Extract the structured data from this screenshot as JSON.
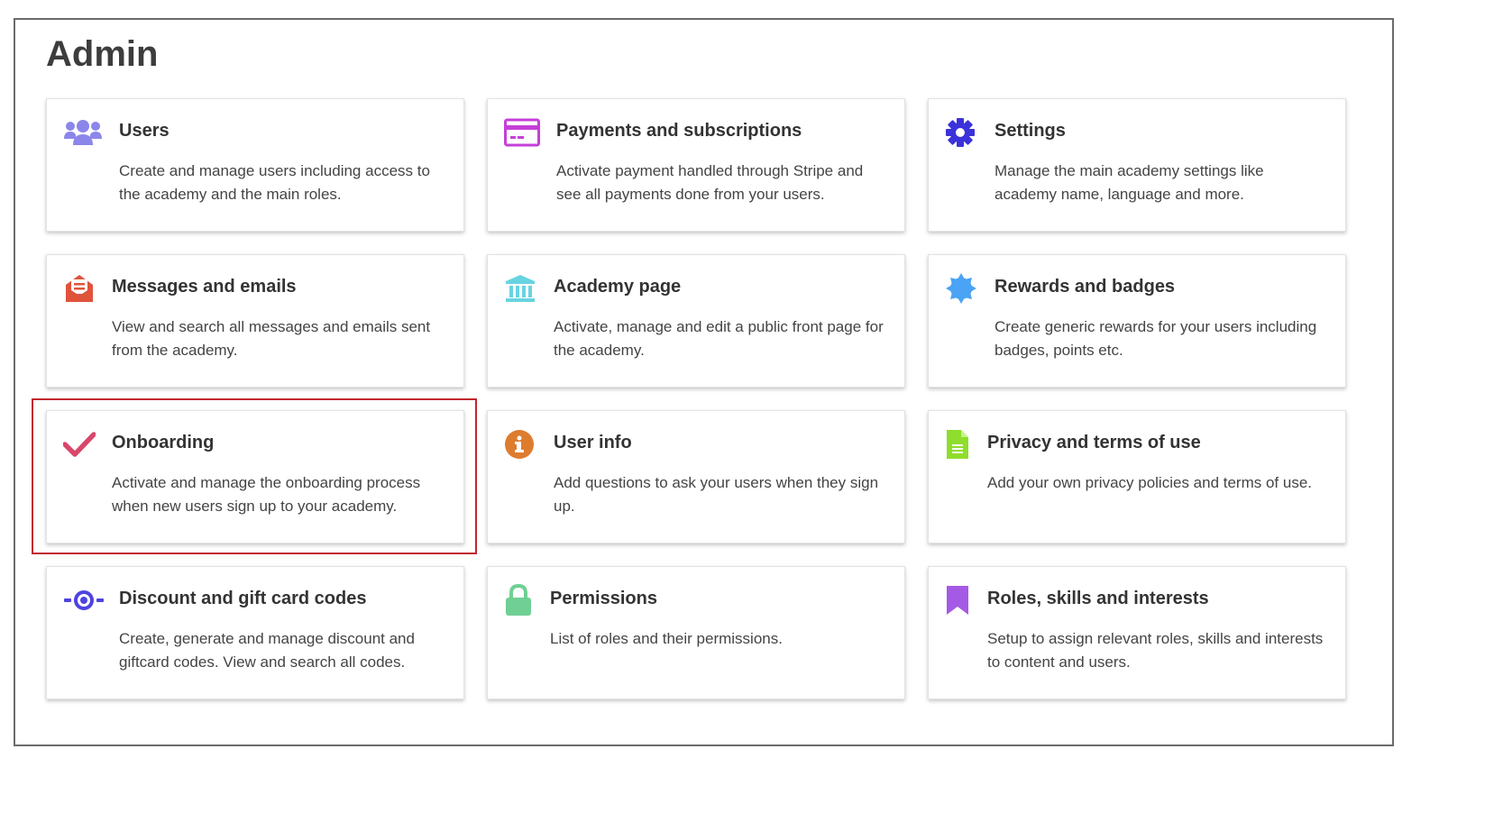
{
  "page": {
    "title": "Admin"
  },
  "cards": [
    {
      "icon": "users-icon",
      "color": "#8b87ea",
      "title": "Users",
      "description": "Create and manage users including access to the academy and the main roles."
    },
    {
      "icon": "credit-card-icon",
      "color": "#c53fd8",
      "title": "Payments and subscriptions",
      "description": "Activate payment handled through Stripe and see all payments done from your users."
    },
    {
      "icon": "gear-icon",
      "color": "#3b32d9",
      "title": "Settings",
      "description": "Manage the main academy settings like academy name, language and more."
    },
    {
      "icon": "envelope-open-icon",
      "color": "#e0533b",
      "title": "Messages and emails",
      "description": "View and search all messages and emails sent from the academy."
    },
    {
      "icon": "bank-icon",
      "color": "#67d4e0",
      "title": "Academy page",
      "description": "Activate, manage and edit a public front page for the academy."
    },
    {
      "icon": "badge-icon",
      "color": "#4aa3f5",
      "title": "Rewards and badges",
      "description": "Create generic rewards for your users including badges, points etc."
    },
    {
      "icon": "checkmark-icon",
      "color": "#d9476b",
      "title": "Onboarding",
      "description": "Activate and manage the onboarding process when new users sign up to your academy.",
      "highlighted": true
    },
    {
      "icon": "info-circle-icon",
      "color": "#de7c2e",
      "title": "User info",
      "description": "Add questions to ask your users when they sign up."
    },
    {
      "icon": "document-icon",
      "color": "#8fdd2c",
      "title": "Privacy and terms of use",
      "description": "Add your own privacy policies and terms of use."
    },
    {
      "icon": "code-commit-icon",
      "color": "#4e43e2",
      "title": "Discount and gift card codes",
      "description": "Create, generate and manage discount and giftcard codes. View and search all codes."
    },
    {
      "icon": "lock-icon",
      "color": "#6fcf94",
      "title": "Permissions",
      "description": "List of roles and their permissions."
    },
    {
      "icon": "bookmark-icon",
      "color": "#a55ae6",
      "title": "Roles, skills and interests",
      "description": "Setup to assign relevant roles, skills and interests to content and users."
    }
  ]
}
